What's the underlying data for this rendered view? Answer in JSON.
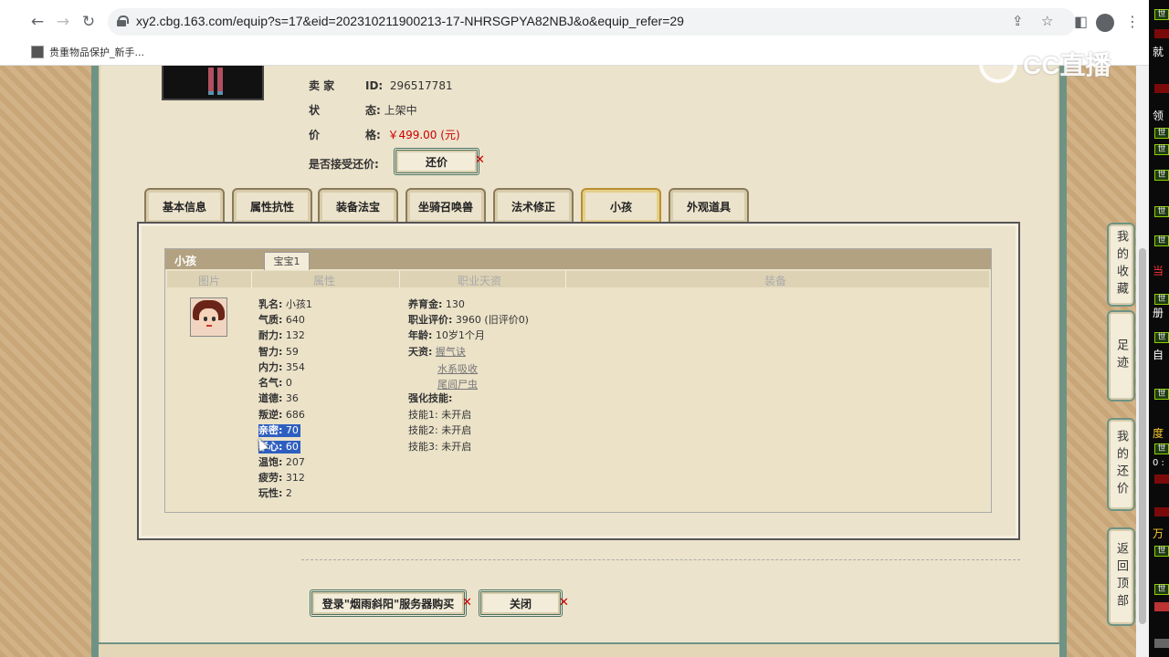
{
  "browser": {
    "url": "xy2.cbg.163.com/equip?s=17&eid=202310211900213-17-NHRSGPYA82NBJ&o&equip_refer=29",
    "bookmark_label": "贵重物品保护_新手..."
  },
  "watermark": "CC直播",
  "seller": {
    "id_key": "卖 家",
    "id_sub": "ID:",
    "id_value": "296517781",
    "status_key": "状",
    "status_sub": "态:",
    "status_value": "上架中",
    "price_key": "价",
    "price_sub": "格:",
    "price_value": "￥499.00 (元)",
    "bargain_label": "是否接受还价:",
    "bargain_button": "还价"
  },
  "tabs": [
    "基本信息",
    "属性抗性",
    "装备法宝",
    "坐骑召唤兽",
    "法术修正",
    "小孩",
    "外观道具"
  ],
  "active_tab": "小孩",
  "child_panel": {
    "title": "小孩",
    "baby_tab": "宝宝1",
    "columns": [
      "图片",
      "属性",
      "职业天资",
      "装备"
    ],
    "attributes": [
      {
        "k": "乳名:",
        "v": "小孩1"
      },
      {
        "k": "气质:",
        "v": "640"
      },
      {
        "k": "耐力:",
        "v": "132"
      },
      {
        "k": "智力:",
        "v": "59"
      },
      {
        "k": "内力:",
        "v": "354"
      },
      {
        "k": "名气:",
        "v": "0"
      },
      {
        "k": "道德:",
        "v": "36"
      },
      {
        "k": "叛逆:",
        "v": "686"
      },
      {
        "k": "亲密:",
        "v": "70"
      },
      {
        "k": "孝心:",
        "v": "60"
      },
      {
        "k": "温饱:",
        "v": "207"
      },
      {
        "k": "疲劳:",
        "v": "312"
      },
      {
        "k": "玩性:",
        "v": "2"
      }
    ],
    "career": [
      {
        "k": "养育金:",
        "v": "130"
      },
      {
        "k": "职业评价:",
        "v": "3960 (旧评价0)"
      },
      {
        "k": "年龄:",
        "v": "10岁1个月"
      },
      {
        "k": "天资:",
        "v": "握气诀"
      }
    ],
    "talents_extra": [
      "水系吸收",
      "尾闾尸虫"
    ],
    "skills_label": "强化技能:",
    "skills": [
      {
        "k": "技能1:",
        "v": "未开启"
      },
      {
        "k": "技能2:",
        "v": "未开启"
      },
      {
        "k": "技能3:",
        "v": "未开启"
      }
    ]
  },
  "footer": {
    "login_button": "登录\"烟雨斜阳\"服务器购买",
    "close_button": "关闭"
  },
  "side_tabs": [
    "我的收藏",
    "足迹",
    "我的还价",
    "返回顶部"
  ],
  "overlay": {
    "tag": "世",
    "texts": [
      "就",
      "领",
      "当",
      "册",
      "自",
      "度",
      "0 :",
      "万"
    ]
  }
}
